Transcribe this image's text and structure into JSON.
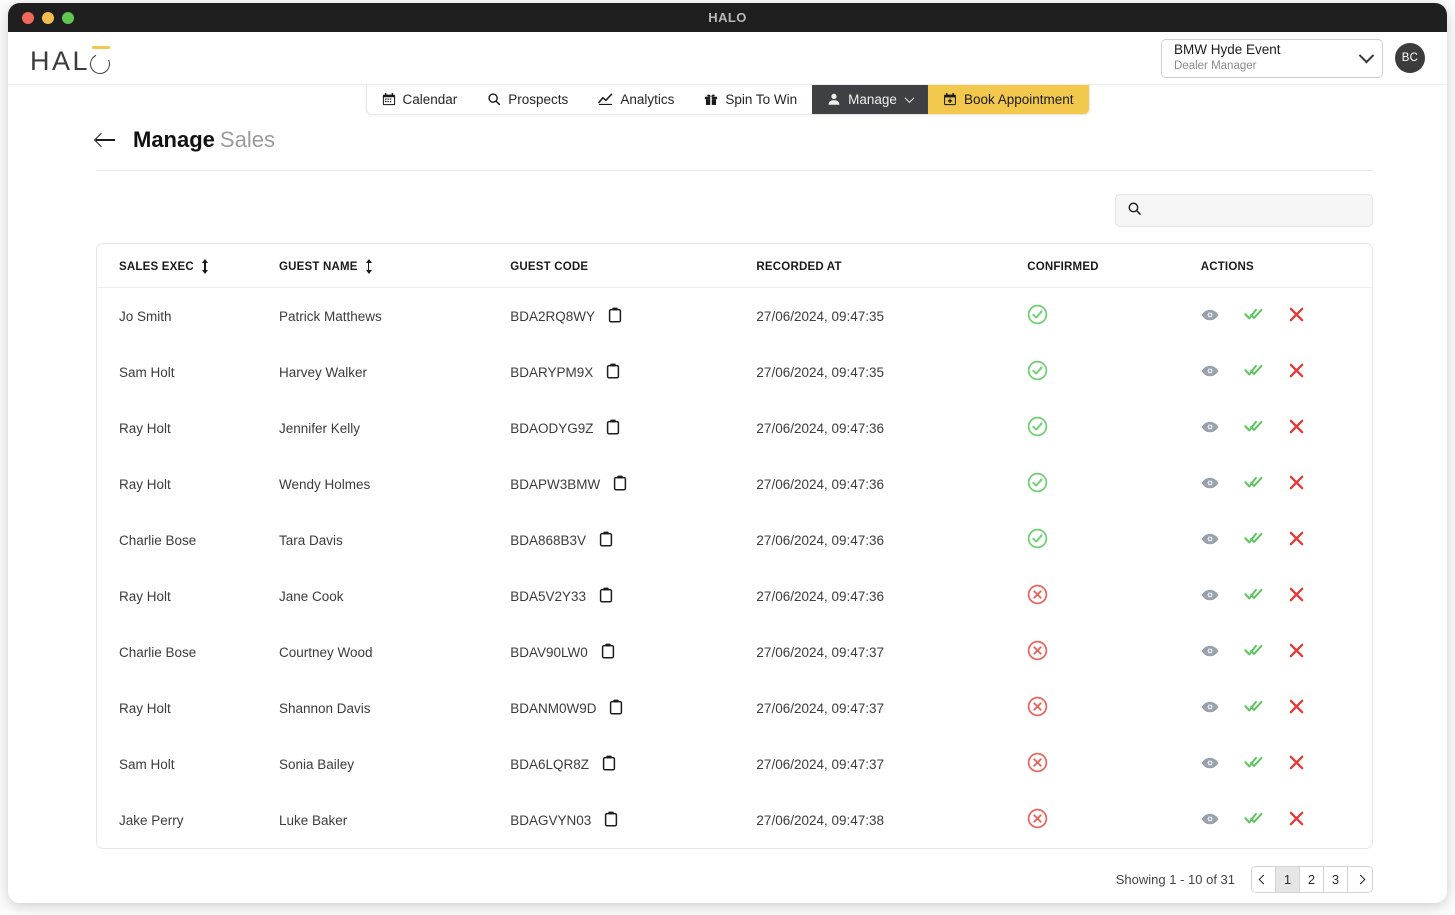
{
  "window": {
    "title": "HALO"
  },
  "brand": {
    "logo_text_prefix": "HAL",
    "logo_icon": "halo-o-icon"
  },
  "header": {
    "event": {
      "name": "BMW Hyde Event",
      "role": "Dealer Manager"
    },
    "avatar_initials": "BC"
  },
  "nav": {
    "tabs": [
      {
        "label": "Calendar",
        "icon": "calendar-icon",
        "state": "default"
      },
      {
        "label": "Prospects",
        "icon": "search-icon",
        "state": "default"
      },
      {
        "label": "Analytics",
        "icon": "line-chart-icon",
        "state": "default"
      },
      {
        "label": "Spin To Win",
        "icon": "gift-icon",
        "state": "default"
      },
      {
        "label": "Manage",
        "icon": "user-icon",
        "state": "active",
        "has_chevron": true
      },
      {
        "label": "Book Appointment",
        "icon": "calendar-plus-icon",
        "state": "accent"
      }
    ]
  },
  "page": {
    "title": "Manage",
    "subtitle": "Sales",
    "back_icon": "back-arrow-icon"
  },
  "search": {
    "value": "",
    "placeholder": "",
    "icon": "search-icon"
  },
  "table": {
    "columns": [
      {
        "key": "sales_exec",
        "label": "SALES EXEC",
        "sortable": true
      },
      {
        "key": "guest_name",
        "label": "GUEST NAME",
        "sortable": true
      },
      {
        "key": "guest_code",
        "label": "GUEST CODE",
        "sortable": false
      },
      {
        "key": "recorded_at",
        "label": "RECORDED AT",
        "sortable": false
      },
      {
        "key": "confirmed",
        "label": "CONFIRMED",
        "sortable": false
      },
      {
        "key": "actions",
        "label": "ACTIONS",
        "sortable": false
      }
    ],
    "rows": [
      {
        "sales_exec": "Jo Smith",
        "guest_name": "Patrick Matthews",
        "guest_code": "BDA2RQ8WY",
        "recorded_at": "27/06/2024, 09:47:35",
        "confirmed": "yes"
      },
      {
        "sales_exec": "Sam Holt",
        "guest_name": "Harvey Walker",
        "guest_code": "BDARYPM9X",
        "recorded_at": "27/06/2024, 09:47:35",
        "confirmed": "yes"
      },
      {
        "sales_exec": "Ray Holt",
        "guest_name": "Jennifer Kelly",
        "guest_code": "BDAODYG9Z",
        "recorded_at": "27/06/2024, 09:47:36",
        "confirmed": "yes"
      },
      {
        "sales_exec": "Ray Holt",
        "guest_name": "Wendy Holmes",
        "guest_code": "BDAPW3BMW",
        "recorded_at": "27/06/2024, 09:47:36",
        "confirmed": "yes"
      },
      {
        "sales_exec": "Charlie Bose",
        "guest_name": "Tara Davis",
        "guest_code": "BDA868B3V",
        "recorded_at": "27/06/2024, 09:47:36",
        "confirmed": "yes"
      },
      {
        "sales_exec": "Ray Holt",
        "guest_name": "Jane Cook",
        "guest_code": "BDA5V2Y33",
        "recorded_at": "27/06/2024, 09:47:36",
        "confirmed": "no"
      },
      {
        "sales_exec": "Charlie Bose",
        "guest_name": "Courtney Wood",
        "guest_code": "BDAV90LW0",
        "recorded_at": "27/06/2024, 09:47:37",
        "confirmed": "no"
      },
      {
        "sales_exec": "Ray Holt",
        "guest_name": "Shannon Davis",
        "guest_code": "BDANM0W9D",
        "recorded_at": "27/06/2024, 09:47:37",
        "confirmed": "no"
      },
      {
        "sales_exec": "Sam Holt",
        "guest_name": "Sonia Bailey",
        "guest_code": "BDA6LQR8Z",
        "recorded_at": "27/06/2024, 09:47:37",
        "confirmed": "no"
      },
      {
        "sales_exec": "Jake Perry",
        "guest_name": "Luke Baker",
        "guest_code": "BDAGVYN03",
        "recorded_at": "27/06/2024, 09:47:38",
        "confirmed": "no"
      }
    ],
    "row_icons": {
      "copy": "clipboard-copy-icon",
      "confirmed_yes": "check-circle-icon",
      "confirmed_no": "x-circle-icon",
      "action_view": "eye-icon",
      "action_confirm": "double-check-icon",
      "action_reject": "x-icon"
    }
  },
  "pagination": {
    "showing": "Showing 1 - 10 of 31",
    "prev_icon": "chevron-left-icon",
    "next_icon": "chevron-right-icon",
    "pages": [
      "1",
      "2",
      "3"
    ],
    "current": "1"
  },
  "colors": {
    "accent": "#f2c94c",
    "active_tab": "#3f4044",
    "success": "#6fcf6f",
    "danger": "#e8514b",
    "muted": "#9b9b9b"
  }
}
